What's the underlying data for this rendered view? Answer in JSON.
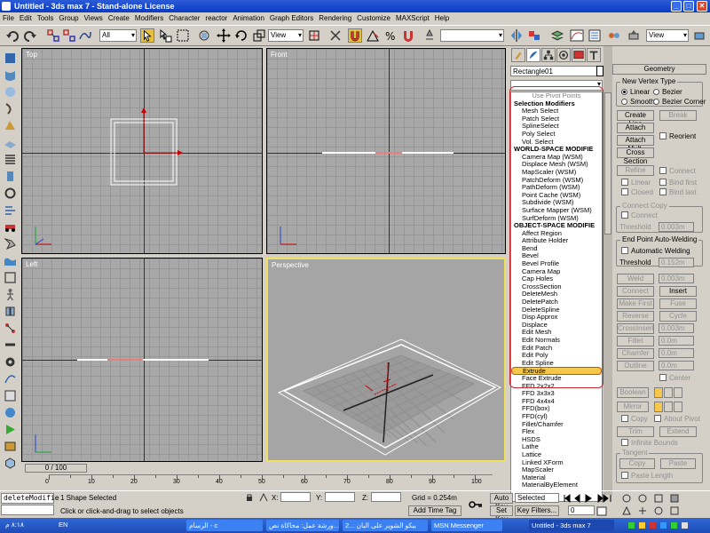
{
  "window": {
    "title": "Untitled - 3ds max 7 - Stand-alone License",
    "min": "_",
    "max": "□",
    "close": "✕"
  },
  "menu": [
    "File",
    "Edit",
    "Tools",
    "Group",
    "Views",
    "Create",
    "Modifiers",
    "Character",
    "reactor",
    "Animation",
    "Graph Editors",
    "Rendering",
    "Customize",
    "MAXScript",
    "Help"
  ],
  "toolbar": {
    "filter": "All",
    "refcoord": "View",
    "view2": "View"
  },
  "viewports": {
    "top": "Top",
    "front": "Front",
    "left": "Left",
    "perspective": "Perspective"
  },
  "command": {
    "object_name": "Rectangle01",
    "modifier_items": [
      {
        "t": "Use Pivot Points",
        "k": "first"
      },
      {
        "t": "Selection Modifiers",
        "k": "hdr"
      },
      {
        "t": "Mesh Select"
      },
      {
        "t": "Patch Select"
      },
      {
        "t": "SplineSelect"
      },
      {
        "t": "Poly Select"
      },
      {
        "t": "Vol. Select"
      },
      {
        "t": "WORLD-SPACE MODIFIE",
        "k": "hdr"
      },
      {
        "t": "Camera Map (WSM)"
      },
      {
        "t": "Displace Mesh (WSM)"
      },
      {
        "t": "MapScaler (WSM)"
      },
      {
        "t": "PatchDeform (WSM)"
      },
      {
        "t": "PathDeform (WSM)"
      },
      {
        "t": "Point Cache (WSM)"
      },
      {
        "t": "Subdivide (WSM)"
      },
      {
        "t": "Surface Mapper (WSM)"
      },
      {
        "t": "SurfDeform (WSM)"
      },
      {
        "t": "OBJECT-SPACE MODIFIE",
        "k": "hdr"
      },
      {
        "t": "Affect Region"
      },
      {
        "t": "Attribute Holder"
      },
      {
        "t": "Bend"
      },
      {
        "t": "Bevel"
      },
      {
        "t": "Bevel Profile"
      },
      {
        "t": "Camera Map"
      },
      {
        "t": "Cap Holes"
      },
      {
        "t": "CrossSection"
      },
      {
        "t": "DeleteMesh"
      },
      {
        "t": "DeletePatch"
      },
      {
        "t": "DeleteSpline"
      },
      {
        "t": "Disp Approx"
      },
      {
        "t": "Displace"
      },
      {
        "t": "Edit Mesh"
      },
      {
        "t": "Edit Normals"
      },
      {
        "t": "Edit Patch"
      },
      {
        "t": "Edit Poly"
      },
      {
        "t": "Edit Spline"
      },
      {
        "t": "Extrude",
        "k": "hl"
      },
      {
        "t": "Face Extrude"
      },
      {
        "t": "FFD 2x2x2"
      },
      {
        "t": "FFD 3x3x3"
      },
      {
        "t": "FFD 4x4x4"
      },
      {
        "t": "FFD(box)"
      },
      {
        "t": "FFD(cyl)"
      },
      {
        "t": "Fillet/Chamfer"
      },
      {
        "t": "Flex"
      },
      {
        "t": "HSDS"
      },
      {
        "t": "Lathe"
      },
      {
        "t": "Lattice"
      },
      {
        "t": "Linked XForm"
      },
      {
        "t": "MapScaler"
      },
      {
        "t": "Material"
      },
      {
        "t": "MaterialByElement"
      }
    ]
  },
  "geometry": {
    "header": "Geometry",
    "new_vertex_type": "New Vertex Type",
    "linear": "Linear",
    "bezier": "Bezier",
    "smooth": "Smooth",
    "bezier_corner": "Bezier Corner",
    "create_line": "Create Line",
    "break": "Break",
    "attach": "Attach",
    "reorient": "Reorient",
    "attach_mult": "Attach Mult.",
    "cross_section": "Cross Section",
    "refine": "Refine",
    "connect": "Connect",
    "linear2": "Linear",
    "bind_first": "Bind first",
    "closed": "Closed",
    "bind_last": "Bind last",
    "connect_copy": "Connect Copy",
    "connect2": "Connect",
    "threshold": "Threshold",
    "threshold_val": "0.003m",
    "end_point_welding": "End Point Auto-Welding",
    "auto_welding": "Automatic Welding",
    "threshold2": "Threshold",
    "threshold2_val": "0.152m",
    "weld": "Weld",
    "weld_val": "0.003m",
    "connect3": "Connect",
    "insert": "Insert",
    "make_first": "Make First",
    "fuse": "Fuse",
    "reverse": "Reverse",
    "cycle": "Cycle",
    "crossinsert": "CrossInsert",
    "crossinsert_val": "0.003m",
    "fillet": "Fillet",
    "fillet_val": "0.0m",
    "chamfer": "Chamfer",
    "chamfer_val": "0.0m",
    "outline": "Outline",
    "outline_val": "0.0m",
    "center": "Center",
    "boolean": "Boolean",
    "mirror": "Mirror",
    "copy": "Copy",
    "about_pivot": "About Pivot",
    "trim": "Trim",
    "extend": "Extend",
    "infinite_bounds": "Infinite Bounds",
    "tangent": "Tangent",
    "copy2": "Copy",
    "paste": "Paste",
    "paste_length": "Paste Length"
  },
  "timeline": {
    "slider": "0 / 100",
    "ticks": [
      0,
      10,
      20,
      30,
      40,
      50,
      60,
      70,
      80,
      90,
      100
    ]
  },
  "status": {
    "name_field": "deleteModifie",
    "selected": "1 Shape Selected",
    "prompt": "Click or click-and-drag to select objects",
    "x_label": "X:",
    "y_label": "Y:",
    "z_label": "Z:",
    "grid": "Grid = 0.254m",
    "add_time_tag": "Add Time Tag",
    "auto_key": "Auto Key",
    "selected_dd": "Selected",
    "set_key": "Set Key",
    "key_filters": "Key Filters...",
    "frame": "0"
  },
  "taskbar": {
    "lang": "EN",
    "tasks": [
      "الرسام - c",
      "ورشة عمل: محاكاة نص...",
      "بيكو الشوير على البان ...2",
      "MSN Messenger",
      "Untitled - 3ds max 7"
    ],
    "clock": "٨:١٨ م"
  }
}
